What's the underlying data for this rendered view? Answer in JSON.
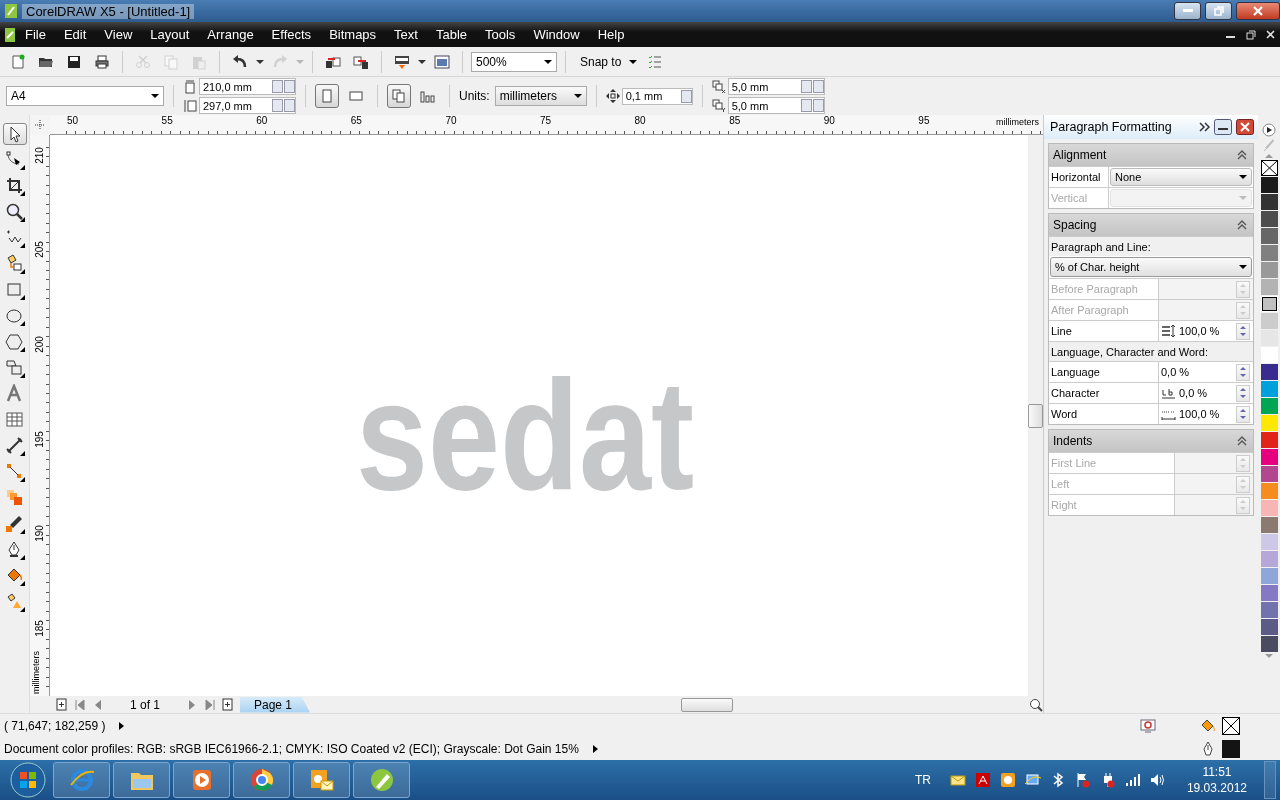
{
  "window": {
    "title": "CorelDRAW X5 - [Untitled-1]"
  },
  "menu": [
    "File",
    "Edit",
    "View",
    "Layout",
    "Arrange",
    "Effects",
    "Bitmaps",
    "Text",
    "Table",
    "Tools",
    "Window",
    "Help"
  ],
  "standard_toolbar": {
    "tools": [
      {
        "disabled": false
      },
      {
        "disabled": false
      },
      {
        "disabled": false
      },
      {
        "disabled": false
      },
      {
        "disabled": true
      },
      {
        "disabled": true
      },
      {
        "disabled": true
      },
      {
        "disabled": false
      },
      {
        "disabled": true
      },
      {
        "disabled": false
      },
      {
        "disabled": false
      },
      {
        "disabled": false
      },
      {
        "disabled": false
      }
    ],
    "zoom": "500%",
    "snap": "Snap to"
  },
  "property_bar": {
    "page_size": "A4",
    "width": "210,0 mm",
    "height": "297,0 mm",
    "orientation": [
      {
        "selected": true
      },
      {
        "selected": false
      }
    ],
    "page_modes": [
      {
        "selected": true
      },
      {
        "selected": false
      }
    ],
    "units_label": "Units:",
    "units": "millimeters",
    "nudge": "0,1 mm",
    "duplicate_x": "5,0 mm",
    "duplicate_y": "5,0 mm"
  },
  "toolbox": [
    {
      "selected": true
    },
    {
      "selected": false
    },
    {
      "selected": false
    },
    {
      "selected": false
    },
    {
      "selected": false
    },
    {
      "selected": false
    },
    {
      "selected": false
    },
    {
      "selected": false
    },
    {
      "selected": false
    },
    {
      "selected": false
    },
    {
      "selected": false
    },
    {
      "selected": false
    },
    {
      "selected": false
    },
    {
      "selected": false
    },
    {
      "selected": false
    },
    {
      "selected": false
    },
    {
      "selected": false
    },
    {
      "selected": false
    },
    {
      "selected": false
    }
  ],
  "rulers": {
    "horizontal": [
      "50",
      "55",
      "60",
      "65",
      "70",
      "75",
      "80",
      "85",
      "90",
      "95"
    ],
    "horizontal_unit": "millimeters",
    "vertical": [
      "210",
      "205",
      "200",
      "195",
      "190",
      "185"
    ],
    "vertical_unit": "millimeters"
  },
  "canvas": {
    "artwork_text": "sedat"
  },
  "page_navigation": {
    "counter": "1 of 1",
    "pages": [
      {
        "label": "Page 1",
        "selected": true
      }
    ]
  },
  "docker": {
    "title": "Paragraph Formatting",
    "sections": [
      {
        "title": "Alignment",
        "expanded": true,
        "items": [
          {
            "kind": "select",
            "label": "Horizontal",
            "value": "None",
            "disabled": false
          },
          {
            "kind": "select",
            "label": "Vertical",
            "disabled": true
          }
        ]
      },
      {
        "title": "Spacing",
        "expanded": true,
        "items": [
          {
            "kind": "heading",
            "label": "Paragraph and Line:"
          },
          {
            "kind": "dropdown",
            "value": "% of Char. height"
          },
          {
            "kind": "spin",
            "label": "Before Paragraph",
            "disabled": true
          },
          {
            "kind": "spin",
            "label": "After Paragraph",
            "disabled": true
          },
          {
            "kind": "spin-line",
            "label": "Line",
            "value": "100,0 %",
            "disabled": false
          },
          {
            "kind": "heading",
            "label": "Language, Character and Word:"
          },
          {
            "kind": "spin",
            "label": "Language",
            "value": "0,0 %",
            "disabled": false
          },
          {
            "kind": "spin-char",
            "label": "Character",
            "value": "0,0 %",
            "disabled": false
          },
          {
            "kind": "spin-word",
            "label": "Word",
            "value": "100,0 %",
            "disabled": false
          }
        ]
      },
      {
        "title": "Indents",
        "expanded": true,
        "items": [
          {
            "kind": "spin-wide",
            "label": "First Line",
            "disabled": true
          },
          {
            "kind": "spin-wide",
            "label": "Left",
            "disabled": true
          },
          {
            "kind": "spin-wide",
            "label": "Right",
            "disabled": true
          }
        ]
      }
    ]
  },
  "palette": [
    {
      "kind": "none",
      "selected": false
    },
    {
      "kind": "solid",
      "color": "#1a1a1a",
      "selected": false
    },
    {
      "kind": "solid",
      "color": "#333333",
      "selected": false
    },
    {
      "kind": "solid",
      "color": "#4d4d4d",
      "selected": false
    },
    {
      "kind": "solid",
      "color": "#666666",
      "selected": false
    },
    {
      "kind": "solid",
      "color": "#808080",
      "selected": false
    },
    {
      "kind": "solid",
      "color": "#999999",
      "selected": false
    },
    {
      "kind": "solid",
      "color": "#b3b3b3",
      "selected": false
    },
    {
      "kind": "solid",
      "color": "#c0c0c0",
      "selected": true
    },
    {
      "kind": "solid",
      "color": "#cccccc",
      "selected": false
    },
    {
      "kind": "solid",
      "color": "#e6e6e6",
      "selected": false
    },
    {
      "kind": "solid",
      "color": "#ffffff",
      "selected": false
    },
    {
      "kind": "solid",
      "color": "#3a2b8f",
      "selected": false
    },
    {
      "kind": "solid",
      "color": "#00a0dc",
      "selected": false
    },
    {
      "kind": "solid",
      "color": "#00a651",
      "selected": false
    },
    {
      "kind": "solid",
      "color": "#ffe800",
      "selected": false
    },
    {
      "kind": "solid",
      "color": "#e2231a",
      "selected": false
    },
    {
      "kind": "solid",
      "color": "#e6007e",
      "selected": false
    },
    {
      "kind": "solid",
      "color": "#b2478f",
      "selected": false
    },
    {
      "kind": "solid",
      "color": "#f68b1f",
      "selected": false
    },
    {
      "kind": "solid",
      "color": "#f7b6b4",
      "selected": false
    },
    {
      "kind": "solid",
      "color": "#8a7a70",
      "selected": false
    },
    {
      "kind": "solid",
      "color": "#cdc8e6",
      "selected": false
    },
    {
      "kind": "solid",
      "color": "#b5a8d8",
      "selected": false
    },
    {
      "kind": "solid",
      "color": "#8ea6d8",
      "selected": false
    },
    {
      "kind": "solid",
      "color": "#8679c4",
      "selected": false
    },
    {
      "kind": "solid",
      "color": "#7272ac",
      "selected": false
    },
    {
      "kind": "solid",
      "color": "#5c5b86",
      "selected": false
    },
    {
      "kind": "solid",
      "color": "#4a4a60",
      "selected": false
    }
  ],
  "status_bar": {
    "coordinates": "( 71,647; 182,259 )",
    "color_profiles": "Document color profiles: RGB: sRGB IEC61966-2.1; CMYK: ISO Coated v2 (ECI); Grayscale: Dot Gain 15%",
    "fill": {
      "kind": "none"
    },
    "outline": {
      "kind": "solid",
      "color": "#141414"
    }
  },
  "taskbar": {
    "language": "TR",
    "time": "11:51",
    "date": "19.03.2012"
  }
}
